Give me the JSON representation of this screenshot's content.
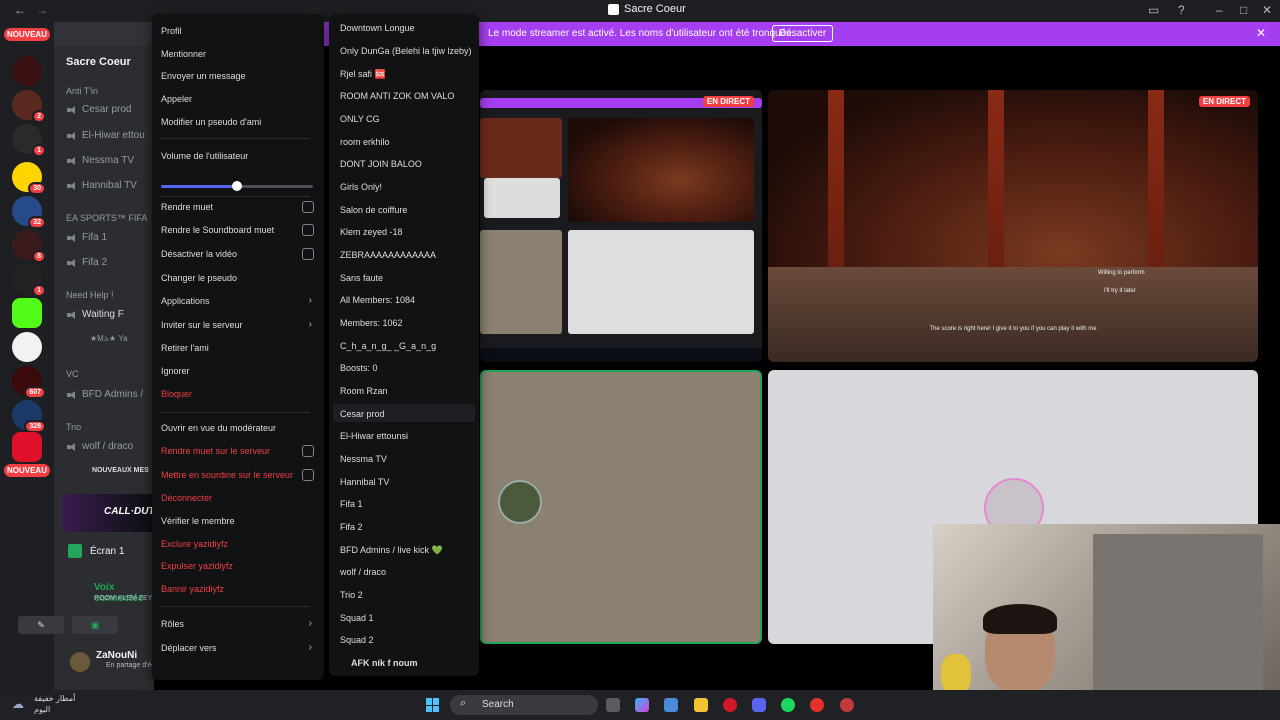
{
  "window": {
    "title": "Sacre Coeur"
  },
  "banner": {
    "text": "Le mode streamer est activé. Les noms d'utilisateur ont été tronqués.",
    "button": "Désactiver"
  },
  "rail": {
    "nouveau_top": "NOUVEAU",
    "nouveau_bottom": "NOUVEAU",
    "badges": [
      "2",
      "3",
      "1",
      "2",
      "30",
      "32",
      "8",
      "1",
      "607",
      "328"
    ]
  },
  "sidebar": {
    "server_name": "Sacre Coeur",
    "categories": [
      "Anti T'in",
      "EA SPORTS™ FIFA",
      "Need Help !",
      "VC",
      "Trio"
    ],
    "channels": [
      "Cesar prod",
      "El-Hiwar ettou",
      "Nessma TV",
      "Hannibal TV",
      "Fifa 1",
      "Fifa 2",
      "Waiting F",
      "BFD Admins /",
      "wolf / draco"
    ],
    "member": "★M৯★ Ya",
    "new_messages": "NOUVEAUX MES",
    "game_banner": "CALL·DUTY.",
    "screen_share": "Écran 1",
    "voice_status": "Voix connectée",
    "voice_channel": "ROOM KLEM ZEYED / Sacre Co",
    "user_name": "ZaNouNi",
    "user_status": "En partage d'écran"
  },
  "user_menu": {
    "items_top": [
      "Profil",
      "Mentionner",
      "Envoyer un message",
      "Appeler",
      "Modifier un pseudo d'ami"
    ],
    "volume_label": "Volume de l'utilisateur",
    "volume_level": 0.5,
    "toggles": [
      "Rendre muet",
      "Rendre le Soundboard muet",
      "Désactiver la vidéo"
    ],
    "items_mid": [
      "Changer le pseudo",
      "Applications",
      "Inviter sur le serveur",
      "Retirer l'ami",
      "Ignorer",
      "Bloquer"
    ],
    "items_mod": [
      "Ouvrir en vue du modérateur",
      "Rendre muet sur le serveur",
      "Mettre en sourdine sur le serveur",
      "Déconnecter",
      "Vérifier le membre",
      "Exclure yazidiyfz",
      "Expulser yazidiyfz",
      "Bannir yazidiyfz"
    ],
    "items_bottom": [
      "Rôles",
      "Déplacer vers"
    ]
  },
  "move_menu": {
    "channels": [
      "Downtown Longue",
      "Only DunGa (Belehi la tjiw lzeby)",
      "Rjel safi 🆘",
      "ROOM ANTI ZOK OM VALO",
      "ONLY CG",
      "room erkhilo",
      "DONT JOIN BALOO",
      "Girls Only!",
      "Salon de coiffure",
      "Klem zeyed -18",
      "ZEBRAAAAAAAAAAAA",
      "Sans faute",
      "All Members: 1084",
      "Members: 1062",
      "C_h_a_n_g_ _G_a_n_g",
      "Boosts: 0",
      "Room Rzan",
      "Cesar prod",
      "El-Hiwar ettounsi",
      "Nessma TV",
      "Hannibal TV",
      "Fifa 1",
      "Fifa 2",
      "BFD Admins / live kick 💚",
      "wolf / draco",
      "Trio 2",
      "Squad 1",
      "Squad 2",
      "AFK nik f noum"
    ]
  },
  "stage": {
    "live_label": "EN DIRECT",
    "game_caption_1": "The score is right here! I give it to you if you can play it with me",
    "game_option_1": "Willing to perform",
    "game_option_2": "I'll try it later"
  },
  "taskbar": {
    "search": "Search",
    "weather_line1": "أمطار خفيفة",
    "weather_line2": "اليوم"
  },
  "colors": {
    "accent": "#5865f2",
    "streamer": "#a43ef0",
    "danger": "#f23f43",
    "online": "#23a55a"
  }
}
